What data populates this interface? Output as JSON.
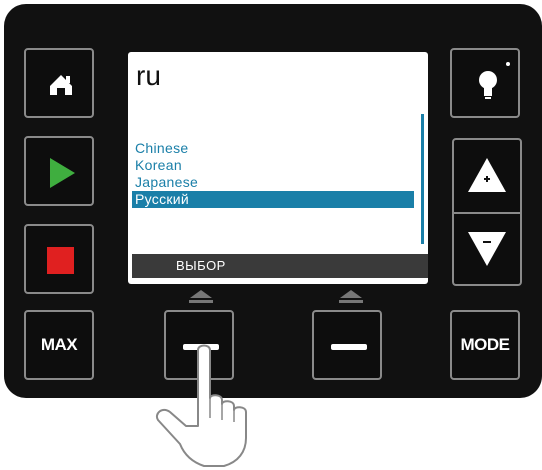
{
  "screen": {
    "query_text": "ru",
    "languages": [
      {
        "label": "Chinese",
        "selected": false
      },
      {
        "label": "Korean",
        "selected": false
      },
      {
        "label": "Japanese",
        "selected": false
      },
      {
        "label": "Русский",
        "selected": true
      }
    ],
    "softkey_label": "ВЫБОР"
  },
  "buttons": {
    "max_label": "MAX",
    "mode_label": "MODE"
  },
  "icons": {
    "home": "home-icon",
    "play": "play-icon",
    "stop": "stop-icon",
    "light": "lightbulb-icon",
    "up": "up-arrow-icon",
    "down": "down-arrow-icon",
    "softkey": "dash-icon",
    "hand": "pointing-hand-icon"
  },
  "colors": {
    "panel": "#111111",
    "accent": "#1a7fa8",
    "play": "#3fae3f",
    "stop": "#e02020"
  }
}
